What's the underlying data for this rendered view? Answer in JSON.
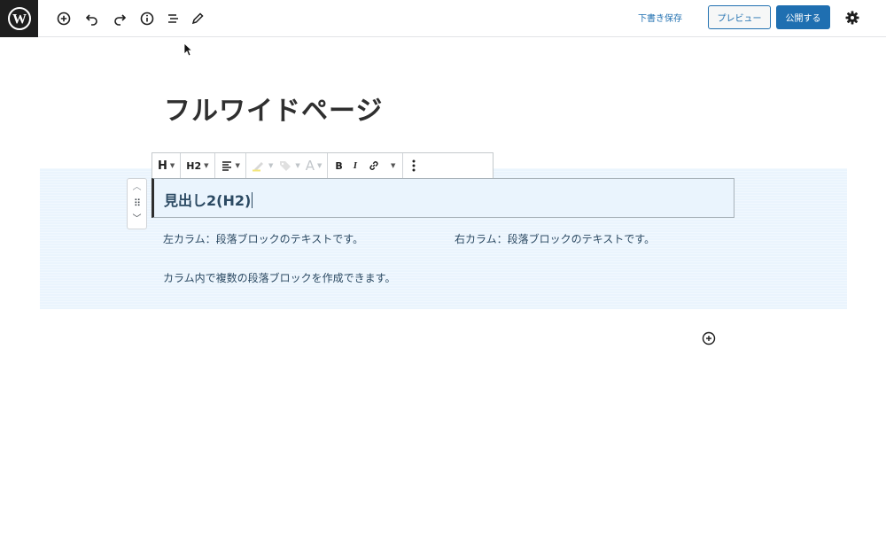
{
  "toolbar": {
    "save_draft_label": "下書き保存",
    "preview_label": "プレビュー",
    "publish_label": "公開する",
    "icons": [
      "wordpress-logo",
      "add-block-icon",
      "undo-icon",
      "redo-icon",
      "info-icon",
      "list-view-icon",
      "tools-icon",
      "settings-icon"
    ]
  },
  "editor": {
    "page_title": "フルワイドページ",
    "block_toolbar": {
      "block_type_label": "H",
      "heading_level_label": "H2",
      "align_icon": "align-left-icon",
      "highlight_icon": "highlighter-icon",
      "tag_icon": "tag-icon",
      "text_color_label": "A",
      "bold_label": "B",
      "italic_label": "I",
      "link_icon": "link-icon",
      "more_icon": "more-vertical-icon"
    },
    "heading_block_text": "見出し2(H2)",
    "left_column_text": "左カラム：段落ブロックのテキストです。",
    "right_column_text": "右カラム：段落ブロックのテキストです。",
    "second_paragraph_text": "カラム内で複数の段落ブロックを作成できます。"
  },
  "colors": {
    "accent": "#1f6fb1",
    "group_background": "#eaf4fd",
    "heading_text": "#2c4a63"
  }
}
